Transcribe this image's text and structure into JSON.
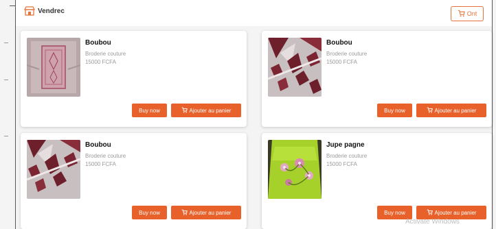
{
  "header": {
    "brand_icon": "shop-icon",
    "brand_text": "Vendrec",
    "cart_label": "Ont",
    "cart_icon": "cart-icon"
  },
  "products": [
    {
      "title": "Boubou",
      "subtitle": "Broderie couture",
      "price": "15000 FCFA",
      "buy_label": "Buy now",
      "add_label": "Ajouter au panier",
      "image": "embroidered-pink-boubou"
    },
    {
      "title": "Boubou",
      "subtitle": "Broderie couture",
      "price": "15000 FCFA",
      "buy_label": "Buy now",
      "add_label": "Ajouter au panier",
      "image": "patterned-burgundy-boubou"
    },
    {
      "title": "Boubou",
      "subtitle": "Broderie couture",
      "price": "15000 FCFA",
      "buy_label": "Buy now",
      "add_label": "Ajouter au panier",
      "image": "patterned-burgundy-boubou"
    },
    {
      "title": "Jupe pagne",
      "subtitle": "Broderie couture",
      "price": "15000 FCFA",
      "buy_label": "Buy now",
      "add_label": "Ajouter au panier",
      "image": "green-floral-skirt"
    }
  ],
  "watermark": "Activate Windows",
  "colors": {
    "accent": "#e8612a",
    "cart_border": "#e8733a"
  }
}
